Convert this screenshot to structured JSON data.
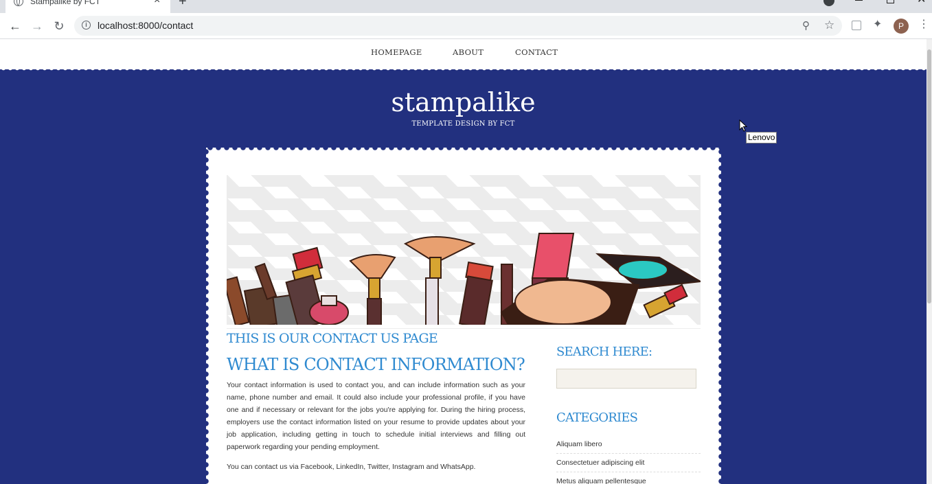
{
  "browser": {
    "tab_title": "Stampalike by FCT",
    "url": "localhost:8000/contact",
    "profile_initial": "P"
  },
  "nav": {
    "items": [
      "HOMEPAGE",
      "ABOUT",
      "CONTACT"
    ]
  },
  "header": {
    "title": "stampalike",
    "tagline": "TEMPLATE DESIGN BY FCT"
  },
  "tooltip": "Lenovo",
  "main": {
    "page_heading": "THIS IS OUR CONTACT US PAGE",
    "section_heading": "WHAT IS CONTACT INFORMATION?",
    "paragraph1": "Your contact information is used to contact you, and can include information such as your name, phone number and email. It could also include your professional profile, if you have one and if necessary or relevant for the jobs you're applying for. During the hiring process, employers use the contact information listed on your resume to provide updates about your job application, including getting in touch to schedule initial interviews and filling out paperwork regarding your pending employment.",
    "paragraph2": "You can contact us via Facebook, LinkedIn, Twitter, Instagram and WhatsApp."
  },
  "sidebar": {
    "search_heading": "SEARCH HERE:",
    "search_value": "",
    "categories_heading": "CATEGORIES",
    "categories": [
      "Aliquam libero",
      "Consectetuer adipiscing elit",
      "Metus aliquam pellentesque"
    ]
  },
  "colors": {
    "page_bg": "#22307f",
    "heading_blue": "#2f8ad0",
    "card_bg": "#ffffff"
  }
}
